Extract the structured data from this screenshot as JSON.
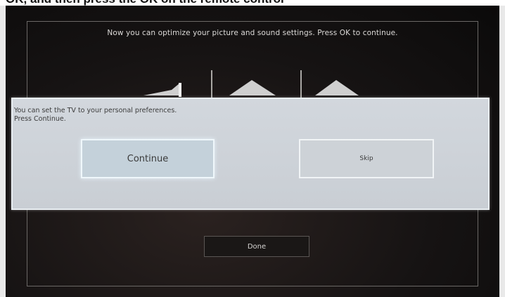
{
  "caption": {
    "text": "OK, and then press the OK on the remote control"
  },
  "setup": {
    "header": "Now you can optimize your picture and sound settings. Press OK to continue."
  },
  "dialog": {
    "line1": "You can set the TV to your personal preferences.",
    "line2": "Press Continue.",
    "continue_label": "Continue",
    "skip_label": "Skip"
  },
  "footer": {
    "done_label": "Done"
  },
  "colors": {
    "screen_bg": "#161313",
    "dialog_bg": "#cdd2d8",
    "focus_glow": "#eff7fb",
    "text_light": "#dcdad8"
  }
}
